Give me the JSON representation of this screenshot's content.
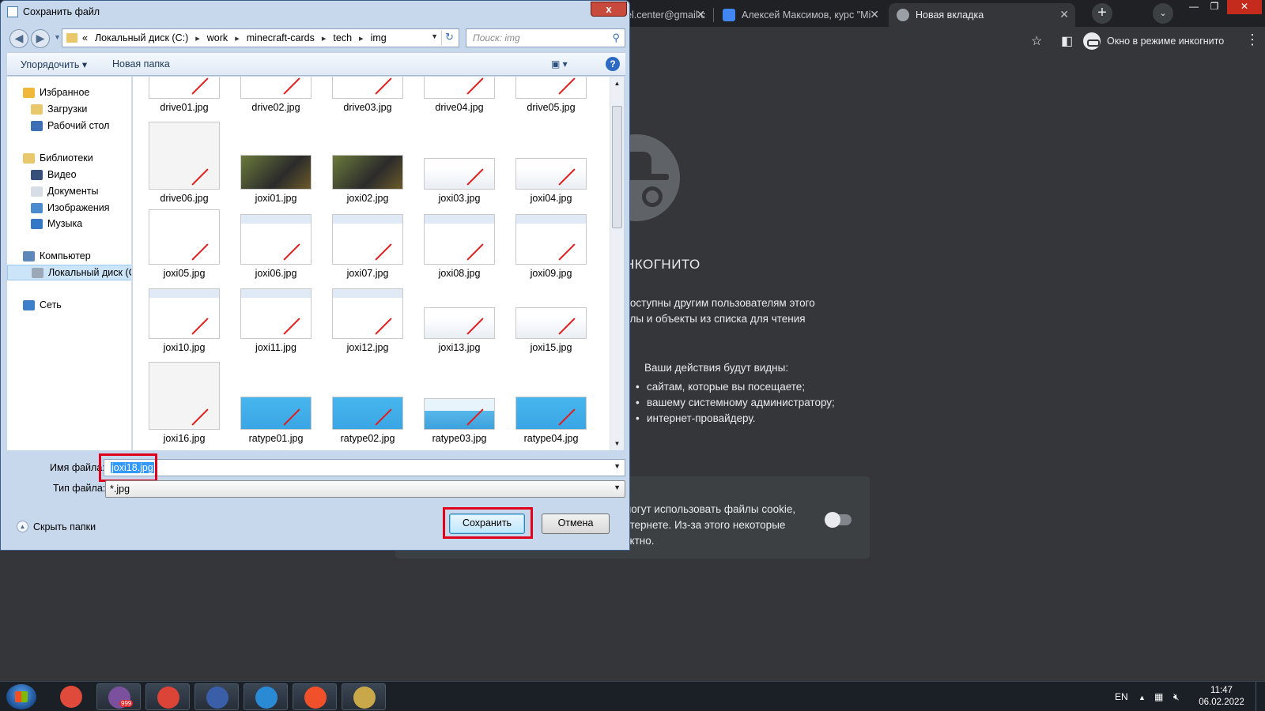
{
  "browser": {
    "tabs": [
      {
        "label": "el.center@gmail.c",
        "icon_color": "#8ab4f8",
        "left": 0
      },
      {
        "label": "Алексей Максимов, курс \"Mi",
        "icon_color": "#4285f4"
      },
      {
        "label": "Новая вкладка",
        "icon_color": "#9aa0a6"
      }
    ],
    "new_tab": "+",
    "incognito_label": "Окно в режиме инкогнито",
    "page": {
      "title": "нкогнито",
      "lines": [
        "доступны другим пользователям этого",
        "йлы и объекты из списка для чтения"
      ],
      "visible_head": "Ваши действия будут видны:",
      "bullets": [
        "сайтам, которые вы посещаете;",
        "вашему системному администратору;",
        "интернет-провайдеру."
      ],
      "cookie_lines": [
        "могут использовать файлы cookie,",
        "нтернете. Из-за этого некоторые",
        "ектно."
      ]
    }
  },
  "dialog": {
    "title": "Сохранить файл",
    "close": "x",
    "address": {
      "prefix": "«",
      "segments": [
        "Локальный диск (C:)",
        "work",
        "minecraft-cards",
        "tech",
        "img"
      ]
    },
    "search_placeholder": "Поиск: img",
    "commands": {
      "organize": "Упорядочить ▾",
      "new_folder": "Новая папка",
      "help": "?"
    },
    "nav": [
      {
        "label": "Избранное",
        "color": "#f0b73a",
        "indent": 0
      },
      {
        "label": "Загрузки",
        "color": "#e8c86a",
        "indent": 1
      },
      {
        "label": "Рабочий стол",
        "color": "#3d6fb5",
        "indent": 1
      },
      {
        "label": "Библиотеки",
        "color": "#e8c86a",
        "indent": 0
      },
      {
        "label": "Видео",
        "color": "#36507a",
        "indent": 1
      },
      {
        "label": "Документы",
        "color": "#d6dde6",
        "indent": 1
      },
      {
        "label": "Изображения",
        "color": "#4a8bd0",
        "indent": 1
      },
      {
        "label": "Музыка",
        "color": "#3478c6",
        "indent": 1
      },
      {
        "label": "Компьютер",
        "color": "#5c87b8",
        "indent": 0
      },
      {
        "label": "Локальный диск (C",
        "color": "#9aa8b8",
        "indent": 1,
        "selected": true
      },
      {
        "label": "Сеть",
        "color": "#3d7fc9",
        "indent": 0
      }
    ],
    "files": [
      {
        "name": "drive01.jpg",
        "kind": "doc"
      },
      {
        "name": "drive02.jpg",
        "kind": "doc"
      },
      {
        "name": "drive03.jpg",
        "kind": "doc"
      },
      {
        "name": "drive04.jpg",
        "kind": "doc"
      },
      {
        "name": "drive05.jpg",
        "kind": "doc"
      },
      {
        "name": "drive06.jpg",
        "kind": "tall"
      },
      {
        "name": "joxi01.jpg",
        "kind": "dark"
      },
      {
        "name": "joxi02.jpg",
        "kind": "dark"
      },
      {
        "name": "joxi03.jpg",
        "kind": "web"
      },
      {
        "name": "joxi04.jpg",
        "kind": "web"
      },
      {
        "name": "joxi05.jpg",
        "kind": "doc"
      },
      {
        "name": "joxi06.jpg",
        "kind": "win"
      },
      {
        "name": "joxi07.jpg",
        "kind": "win"
      },
      {
        "name": "joxi08.jpg",
        "kind": "win"
      },
      {
        "name": "joxi09.jpg",
        "kind": "win"
      },
      {
        "name": "joxi10.jpg",
        "kind": "win"
      },
      {
        "name": "joxi11.jpg",
        "kind": "win"
      },
      {
        "name": "joxi12.jpg",
        "kind": "win"
      },
      {
        "name": "joxi13.jpg",
        "kind": "web"
      },
      {
        "name": "joxi15.jpg",
        "kind": "web"
      },
      {
        "name": "joxi16.jpg",
        "kind": "tall"
      },
      {
        "name": "ratype01.jpg",
        "kind": "blue"
      },
      {
        "name": "ratype02.jpg",
        "kind": "blue"
      },
      {
        "name": "ratype03.jpg",
        "kind": "blue2"
      },
      {
        "name": "ratype04.jpg",
        "kind": "blue"
      }
    ],
    "file_name_label": "Имя файла:",
    "file_name_value": "joxi18.jpg",
    "file_type_label": "Тип файла:",
    "file_type_value": "*.jpg",
    "hide_folders": "Скрыть папки",
    "save": "Сохранить",
    "cancel": "Отмена",
    "highlight_color": "#e0001b"
  },
  "taskbar": {
    "apps": [
      {
        "name": "chrome",
        "color": "#e04a3a"
      },
      {
        "name": "viber",
        "color": "#7b519d",
        "badge": "999"
      },
      {
        "name": "chrome-profile",
        "color": "#db4437"
      },
      {
        "name": "save-app",
        "color": "#3b5ea8"
      },
      {
        "name": "vscode",
        "color": "#2a8ad4"
      },
      {
        "name": "git",
        "color": "#f0512a"
      },
      {
        "name": "paint",
        "color": "#c9a84a"
      }
    ],
    "lang": "EN",
    "time": "11:47",
    "date": "06.02.2022"
  }
}
